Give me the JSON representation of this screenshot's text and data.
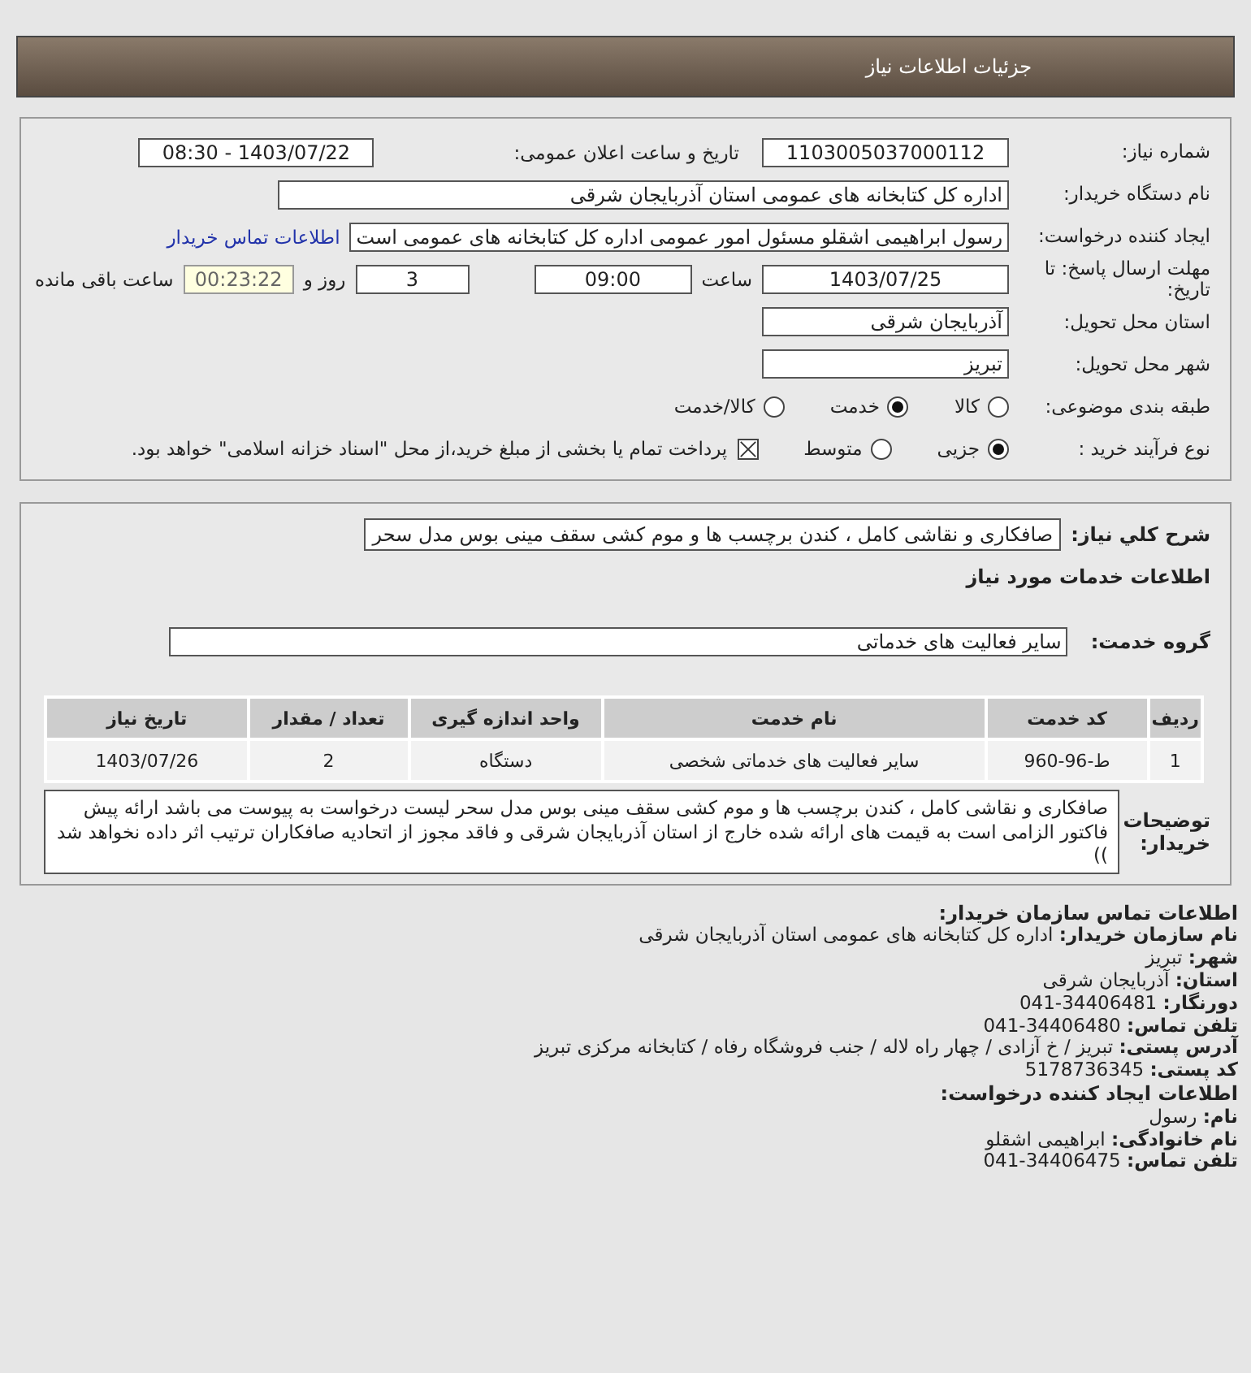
{
  "header": {
    "title": "جزئیات اطلاعات نیاز"
  },
  "need_number": {
    "label": "شماره نیاز:",
    "value": "1103005037000112"
  },
  "announce": {
    "label": "تاریخ و ساعت اعلان عمومی:",
    "value": "1403/07/22 - 08:30"
  },
  "buyer": {
    "label": "نام دستگاه خریدار:",
    "value": "اداره کل کتابخانه های عمومی استان آذربایجان شرقی"
  },
  "requester": {
    "label": "ایجاد کننده درخواست:",
    "value": "رسول ابراهیمی اشقلو مسئول امور عمومی اداره کل کتابخانه های عمومی است",
    "link": "اطلاعات تماس خریدار"
  },
  "deadline": {
    "label": "مهلت ارسال پاسخ: تا تاریخ:",
    "date": "1403/07/25",
    "time_label": "ساعت",
    "time": "09:00",
    "days": "3",
    "days_label": "روز و",
    "remaining": "00:23:22",
    "remaining_label": "ساعت باقی مانده"
  },
  "province": {
    "label": "استان محل تحویل:",
    "value": "آذربایجان شرقی"
  },
  "city": {
    "label": "شهر محل تحویل:",
    "value": "تبریز"
  },
  "category": {
    "label": "طبقه بندی موضوعی:",
    "options": [
      {
        "label": "کالا",
        "selected": false
      },
      {
        "label": "خدمت",
        "selected": true
      },
      {
        "label": "کالا/خدمت",
        "selected": false
      }
    ]
  },
  "process": {
    "label": "نوع فرآیند خرید :",
    "options": [
      {
        "label": "جزیی",
        "selected": true
      },
      {
        "label": "متوسط",
        "selected": false
      }
    ],
    "payment": {
      "checked": true,
      "text": "پرداخت تمام یا بخشی از مبلغ خرید،از محل \"اسناد خزانه اسلامی\" خواهد بود."
    }
  },
  "description": {
    "label": "شرح کلي نیاز:",
    "value": "صافکاری و نقاشی کامل ، کندن برچسب ها و موم کشی سقف مینی بوس مدل سحر"
  },
  "services_title": "اطلاعات خدمات مورد نیاز",
  "service_group": {
    "label": "گروه خدمت:",
    "value": "سایر فعالیت های خدماتی"
  },
  "table": {
    "columns": [
      "ردیف",
      "کد خدمت",
      "نام خدمت",
      "واحد اندازه گیری",
      "تعداد / مقدار",
      "تاریخ نیاز"
    ],
    "rows": [
      [
        "1",
        "ط-96-960",
        "سایر فعالیت های خدماتی شخصی",
        "دستگاه",
        "2",
        "1403/07/26"
      ]
    ]
  },
  "buyer_notes": {
    "label": "توضیحات خریدار:",
    "value": "صافکاری و نقاشی کامل ، کندن برچسب ها و موم کشی سقف مینی بوس مدل سحر لیست درخواست به پیوست می باشد ارائه پیش فاکتور الزامی است به قیمت های ارائه شده خارج از استان آذربایجان شرقی و فاقد مجوز از اتحادیه صافکاران ترتیب اثر داده نخواهد شد ))"
  },
  "contact": [
    {
      "kind": "heading",
      "text": "اطلاعات تماس سازمان خریدار:"
    },
    {
      "kind": "field",
      "label": "نام سازمان خریدار:",
      "value": "اداره کل کتابخانه های عمومی استان آذربایجان شرقی"
    },
    {
      "kind": "field",
      "label": "شهر:",
      "value": "تبریز"
    },
    {
      "kind": "field",
      "label": "استان:",
      "value": "آذربایجان شرقی"
    },
    {
      "kind": "field",
      "label": "دورنگار:",
      "value": "34406481-041"
    },
    {
      "kind": "field",
      "label": "تلفن تماس:",
      "value": "34406480-041"
    },
    {
      "kind": "field",
      "label": "آدرس پستی:",
      "value": "تبریز / خ آزادی / چهار راه لاله / جنب فروشگاه رفاه / کتابخانه مرکزی تبریز"
    },
    {
      "kind": "field",
      "label": "کد پستی:",
      "value": "5178736345"
    },
    {
      "kind": "heading",
      "text": "اطلاعات ایجاد کننده درخواست:"
    },
    {
      "kind": "field",
      "label": "نام:",
      "value": "رسول"
    },
    {
      "kind": "field",
      "label": "نام خانوادگی:",
      "value": "ابراهیمی اشقلو"
    },
    {
      "kind": "field",
      "label": "تلفن تماس:",
      "value": "34406475-041"
    }
  ]
}
